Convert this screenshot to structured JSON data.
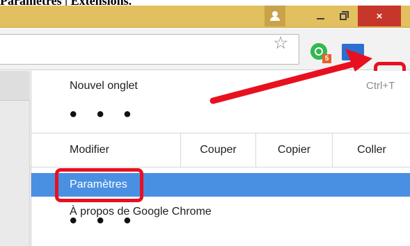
{
  "caption": {
    "text": "Paramètres | Extensions."
  },
  "titlebar": {
    "profile_icon": "person-icon",
    "minimize_icon": "minimize-icon",
    "restore_icon": "restore-icon",
    "close_label": "×"
  },
  "toolbar": {
    "bookmark_icon": "star-icon",
    "extension_icon": "green-ring-extension-icon",
    "extension_badge": "5",
    "cast_icon": "cast-icon",
    "menu_icon": "chrome-menu-icon"
  },
  "menu": {
    "new_tab": {
      "label": "Nouvel onglet",
      "shortcut": "Ctrl+T"
    },
    "ellipsis_1": "• • •",
    "edit": {
      "label": "Modifier",
      "cut": "Couper",
      "copy": "Copier",
      "paste": "Coller"
    },
    "settings": {
      "label": "Paramètres"
    },
    "about": {
      "label": "À propos de Google Chrome"
    },
    "ellipsis_2": "• • •"
  },
  "colors": {
    "titlebar": "#e2bf5f",
    "close": "#c7362b",
    "highlight": "#4a90e2",
    "annotation_red": "#e8101f"
  }
}
